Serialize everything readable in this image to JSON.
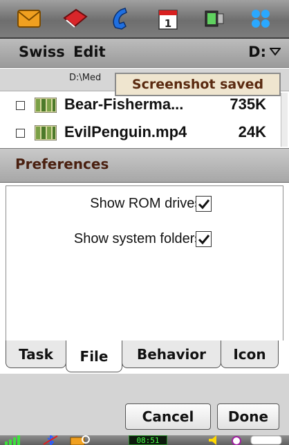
{
  "app_bar": {
    "icons": [
      "envelope-icon",
      "book-icon",
      "phone-icon",
      "calendar-icon",
      "media-icon",
      "apps-grid-icon"
    ],
    "calendar_day": "1"
  },
  "menu": {
    "swiss": "Swiss",
    "edit": "Edit",
    "drive": "D:"
  },
  "file_list": {
    "path": "D:\\Med",
    "toast": "Screenshot saved",
    "files": [
      {
        "name": "Bear-Fisherma...",
        "size": "735K"
      },
      {
        "name": "EvilPenguin.mp4",
        "size": "24K"
      }
    ]
  },
  "dialog": {
    "title": "Preferences",
    "options": [
      {
        "label": "Show ROM drives:",
        "checked": true
      },
      {
        "label": "Show system folders:",
        "checked": true
      }
    ],
    "tabs": [
      "Task",
      "File",
      "Behavior",
      "Icon"
    ],
    "active_tab": "File",
    "cancel": "Cancel",
    "done": "Done"
  },
  "status_bar": {
    "time": "08:51"
  },
  "colors": {
    "title_text": "#4a2010",
    "toast_bg": "#efe5cf",
    "clock_green": "#49ff49"
  }
}
